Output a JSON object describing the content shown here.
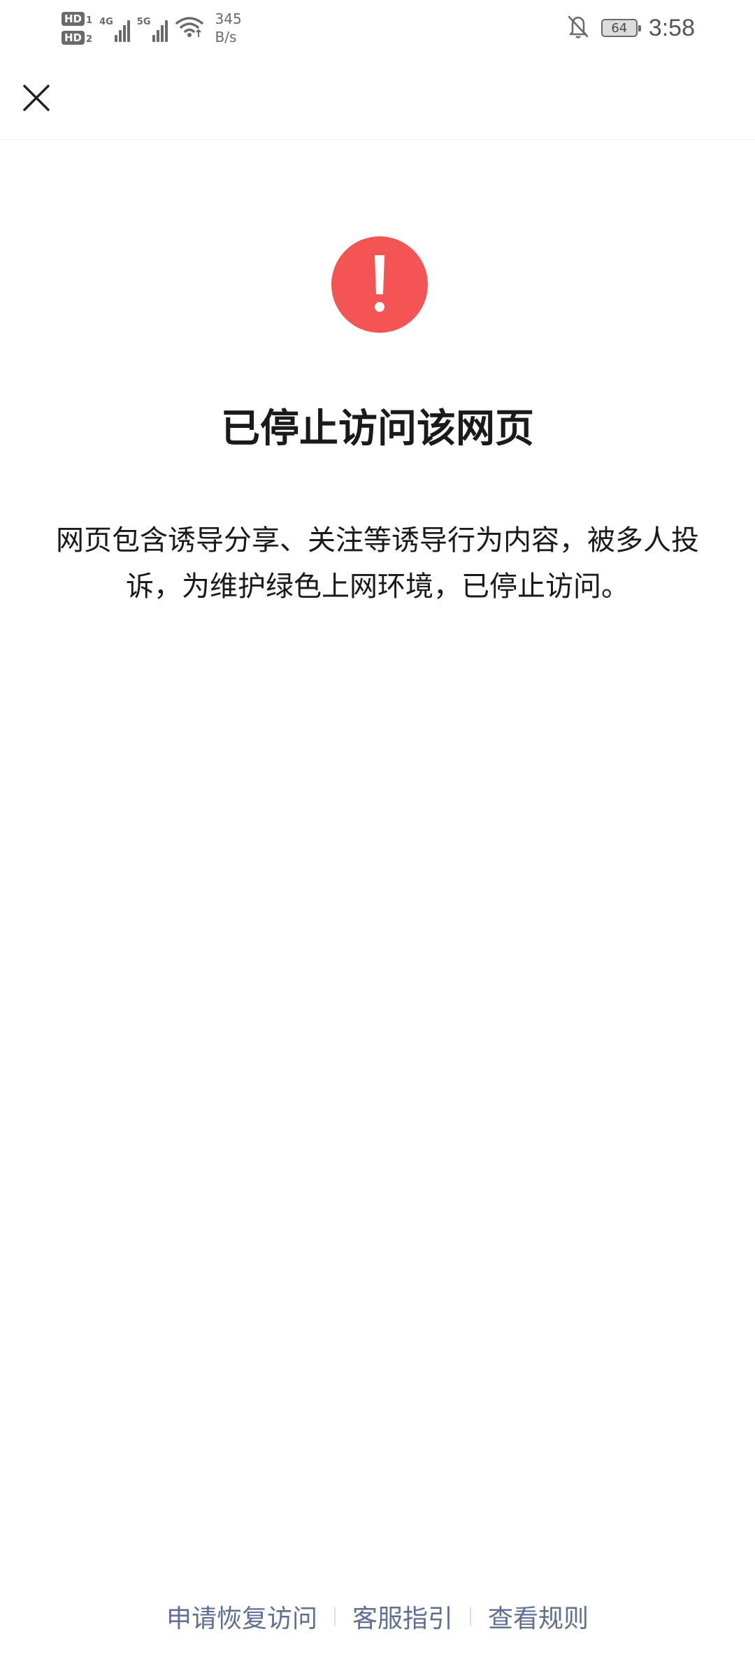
{
  "status_bar": {
    "sim1_label": "HD",
    "sim1_index": "1",
    "sim2_label": "HD",
    "sim2_index": "2",
    "network1": "4G",
    "network2": "5G",
    "speed_value": "345",
    "speed_unit": "B/s",
    "battery_level": "64",
    "time": "3:58",
    "icons": [
      "signal-icon",
      "wifi-icon",
      "bell-muted-icon",
      "battery-icon"
    ]
  },
  "nav": {
    "close_icon": "close-icon"
  },
  "main": {
    "alert_icon": "exclamation-icon",
    "alert_color": "#f45454",
    "title": "已停止访问该网页",
    "description": "网页包含诱导分享、关注等诱导行为内容，被多人投诉，为维护绿色上网环境，已停止访问。"
  },
  "footer": {
    "links": [
      {
        "label": "申请恢复访问"
      },
      {
        "label": "客服指引"
      },
      {
        "label": "查看规则"
      }
    ],
    "link_color": "#5f6f94"
  }
}
